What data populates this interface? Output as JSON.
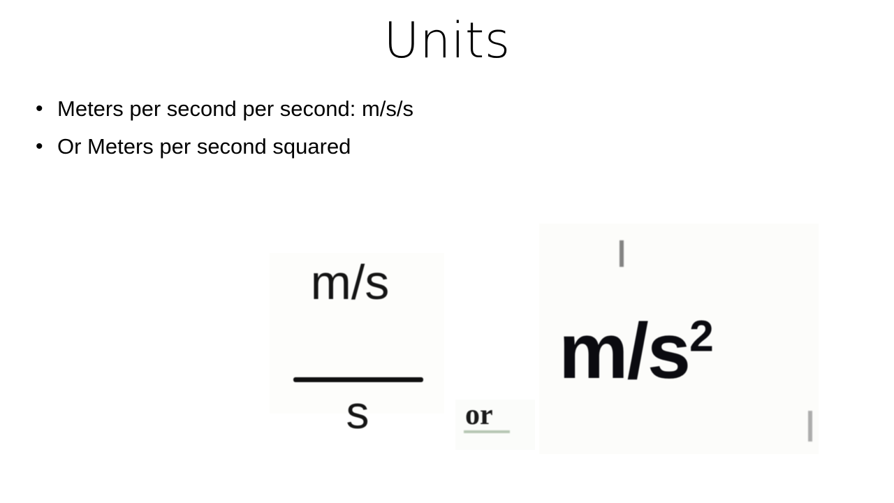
{
  "slide": {
    "title": "Units",
    "background_color": "#ffffff",
    "text_color": "#000000"
  },
  "bullets": [
    {
      "marker": "•",
      "text": "Meters per second per second: m/s/s"
    },
    {
      "marker": "•",
      "text": "Or Meters per second squared"
    }
  ],
  "figures": {
    "fraction": {
      "numerator": "m/s",
      "denominator": "s",
      "description": "m/s over s fraction"
    },
    "connector": {
      "text": "or",
      "underline_color": "#7d9b78"
    },
    "squared": {
      "base": "m/s",
      "exponent": "2",
      "description": "m per s squared"
    }
  }
}
